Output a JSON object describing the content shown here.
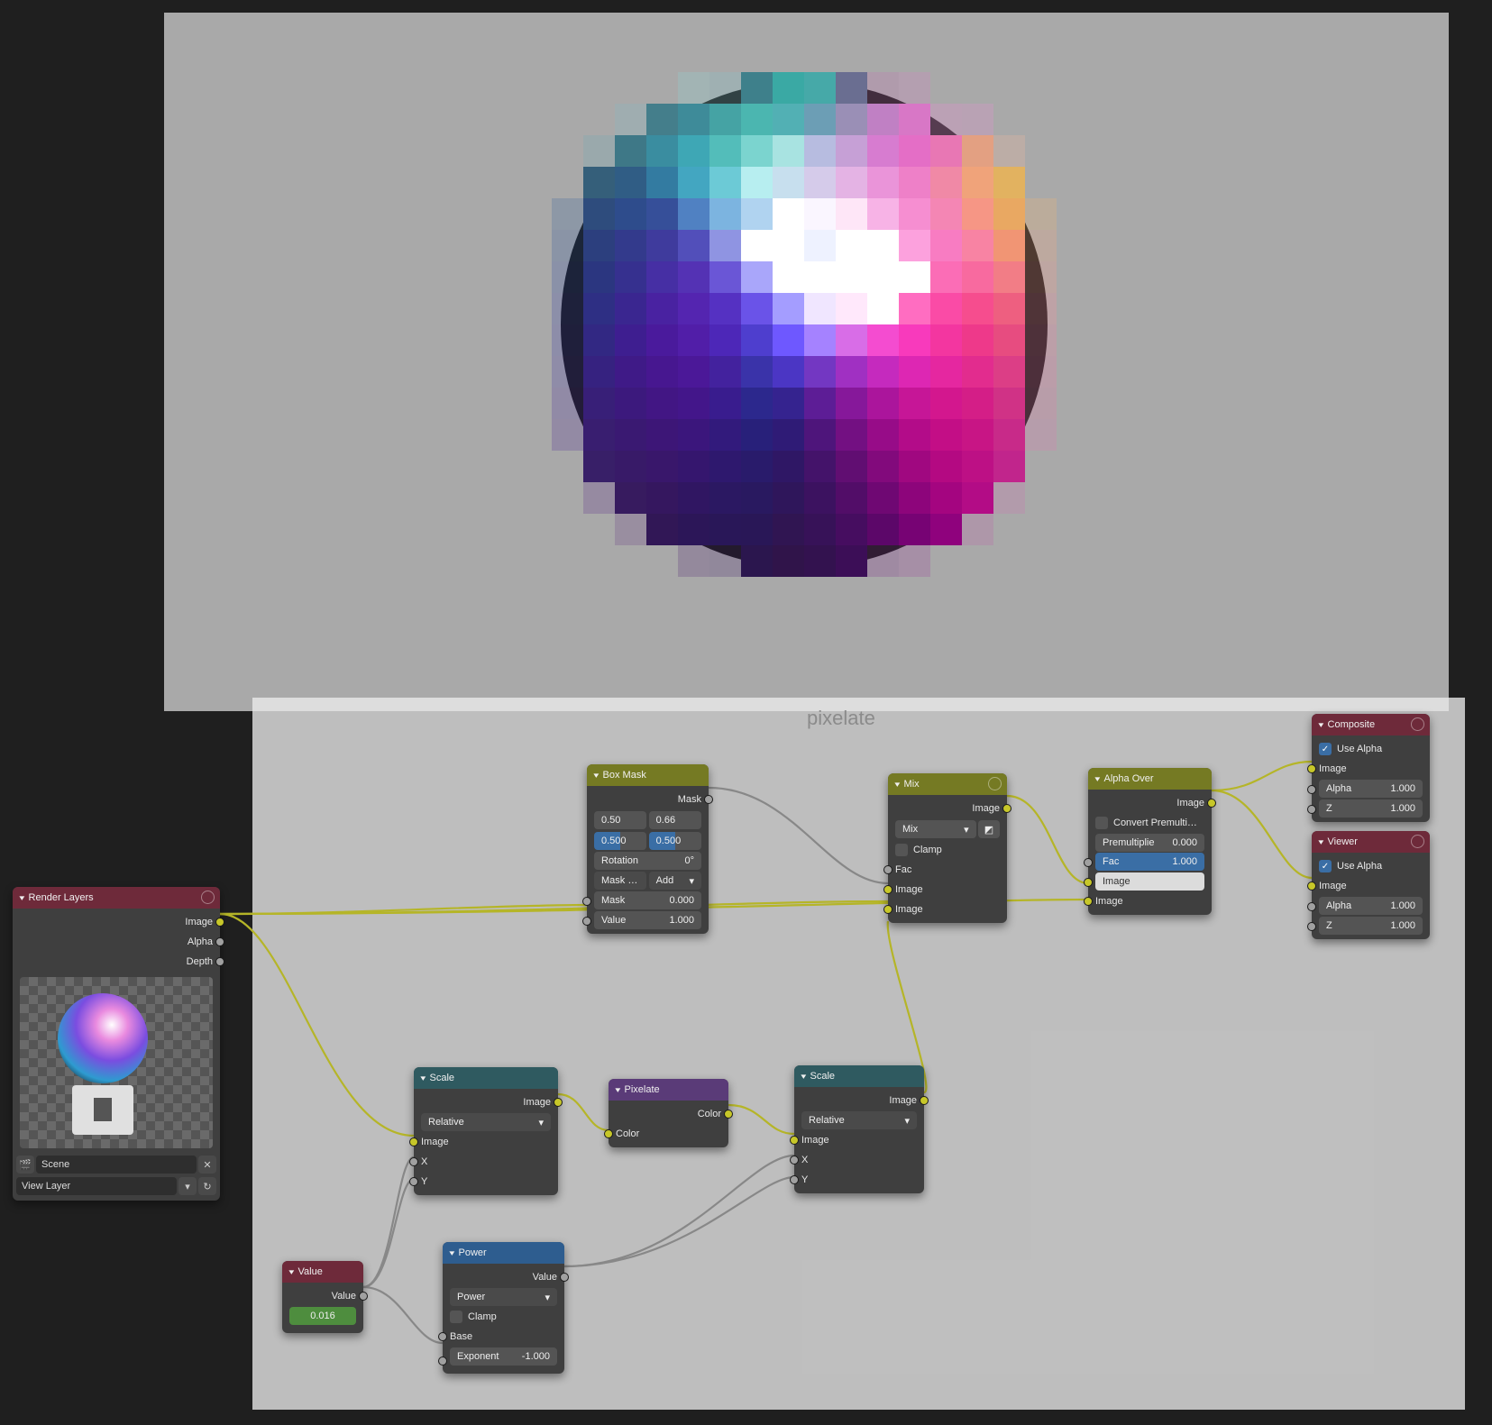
{
  "group_label": "pixelate",
  "render_layers": {
    "title": "Render Layers",
    "out_image": "Image",
    "out_alpha": "Alpha",
    "out_depth": "Depth",
    "scene_label": "Scene",
    "viewlayer_label": "View Layer"
  },
  "box_mask": {
    "title": "Box Mask",
    "out_mask": "Mask",
    "vals": [
      "0.50",
      "0.66",
      "0.500",
      "0.500"
    ],
    "rotation_lbl": "Rotation",
    "rotation_val": "0°",
    "masktype_lbl": "Mask …",
    "masktype_val": "Add",
    "in_mask_lbl": "Mask",
    "in_mask_val": "0.000",
    "in_value_lbl": "Value",
    "in_value_val": "1.000"
  },
  "mix": {
    "title": "Mix",
    "out_image": "Image",
    "mode": "Mix",
    "clamp": "Clamp",
    "in_fac": "Fac",
    "in_image1": "Image",
    "in_image2": "Image"
  },
  "alpha_over": {
    "title": "Alpha Over",
    "out_image": "Image",
    "convert": "Convert Premulti…",
    "premul_lbl": "Premultiplie",
    "premul_val": "0.000",
    "fac_lbl": "Fac",
    "fac_val": "1.000",
    "in_image1": "Image",
    "in_image2": "Image"
  },
  "composite": {
    "title": "Composite",
    "use_alpha": "Use Alpha",
    "in_image": "Image",
    "alpha_lbl": "Alpha",
    "alpha_val": "1.000",
    "z_lbl": "Z",
    "z_val": "1.000"
  },
  "viewer": {
    "title": "Viewer",
    "use_alpha": "Use Alpha",
    "in_image": "Image",
    "alpha_lbl": "Alpha",
    "alpha_val": "1.000",
    "z_lbl": "Z",
    "z_val": "1.000"
  },
  "scale1": {
    "title": "Scale",
    "out_image": "Image",
    "mode": "Relative",
    "in_image": "Image",
    "in_x": "X",
    "in_y": "Y"
  },
  "scale2": {
    "title": "Scale",
    "out_image": "Image",
    "mode": "Relative",
    "in_image": "Image",
    "in_x": "X",
    "in_y": "Y"
  },
  "pixelate": {
    "title": "Pixelate",
    "out_color": "Color",
    "in_color": "Color"
  },
  "value_node": {
    "title": "Value",
    "out_value": "Value",
    "val": "0.016"
  },
  "power": {
    "title": "Power",
    "out_value": "Value",
    "mode": "Power",
    "clamp": "Clamp",
    "in_base": "Base",
    "exp_lbl": "Exponent",
    "exp_val": "-1.000"
  },
  "pixel_colors": [
    [
      "",
      "",
      "",
      "",
      "rgba(150,200,200,0.35)",
      "rgba(140,190,195,0.35)",
      "#3e808b",
      "#3aa9a4",
      "#46a9a8",
      "#6a6e91",
      "rgba(188,128,178,0.35)",
      "rgba(200,140,190,0.35)",
      "",
      "",
      "",
      ""
    ],
    [
      "",
      "",
      "rgba(140,180,190,0.35)",
      "#447e8b",
      "#3e8b99",
      "#45a3a4",
      "#4bb6b0",
      "#52b0b4",
      "#6c9eb5",
      "#9a8fb6",
      "#c080c4",
      "#d877c6",
      "rgba(214,150,200,0.4)",
      "rgba(214,150,200,0.35)",
      "",
      ""
    ],
    [
      "",
      "rgba(120,170,180,0.3)",
      "#3e7887",
      "#3a8da0",
      "#3ea7b5",
      "#53bdba",
      "#7bd4cf",
      "#a8e3e1",
      "#b7bce0",
      "#c6a0d6",
      "#d77cd0",
      "#e46ec6",
      "#e877b4",
      "#e3a082",
      "rgba(224,180,160,0.35)",
      ""
    ],
    [
      "",
      "#355f7a",
      "#305d85",
      "#337ba1",
      "#43a6c1",
      "#6ccad6",
      "#b7eef0",
      "#c7dfee",
      "#d5cbea",
      "#e4b3e4",
      "#ea94d9",
      "#ee80c8",
      "#f089a6",
      "#f0a37a",
      "#e2b260",
      ""
    ],
    [
      "rgba(90,120,160,0.35)",
      "#2e4c7d",
      "#2e4c8c",
      "#364f99",
      "#5081c2",
      "#7cb4e0",
      "#b0d3f0",
      "#ffffff",
      "#faf6ff",
      "#fee6f7",
      "#f7b3e6",
      "#f68ed1",
      "#f486b4",
      "#f69685",
      "#e9a862",
      "rgba(222,178,130,0.35)"
    ],
    [
      "rgba(80,110,160,0.35)",
      "#2c3f7e",
      "#333a8c",
      "#3f3b9d",
      "#524fba",
      "#8f94e2",
      "#ffffff",
      "#ffffff",
      "#eef2ff",
      "#ffffff",
      "#ffffff",
      "#fca1dd",
      "#f87cc2",
      "#f883a3",
      "#f19574",
      "rgba(226,170,140,0.35)"
    ],
    [
      "rgba(80,100,165,0.35)",
      "#2b3680",
      "#36308f",
      "#462fa4",
      "#5432b4",
      "#6a56d6",
      "#a9a6fa",
      "#ffffff",
      "#ffffff",
      "#ffffff",
      "#ffffff",
      "#ffffff",
      "#fb6db6",
      "#f86a9f",
      "#f27d86",
      "rgba(230,160,150,0.35)"
    ],
    [
      "rgba(85,95,170,0.35)",
      "#2e2f84",
      "#3a2690",
      "#4922a1",
      "#5425b0",
      "#5531c2",
      "#6a53e8",
      "#a49dff",
      "#f0e6ff",
      "#ffe8fb",
      "#ffffff",
      "#ff6dc1",
      "#fa4ba6",
      "#f64d8e",
      "#ee5f80",
      "rgba(228,148,160,0.35)"
    ],
    [
      "rgba(90,90,170,0.35)",
      "#322883",
      "#3e1e90",
      "#4a1a9c",
      "#511ea8",
      "#4d27b8",
      "#4e3ece",
      "#6e58ff",
      "#a582ff",
      "#d86de7",
      "#f44cd0",
      "#f83abc",
      "#f336a0",
      "#ee398a",
      "#e74c80",
      "rgba(224,140,165,0.35)"
    ],
    [
      "rgba(95,85,165,0.35)",
      "#362280",
      "#3f1a87",
      "#471790",
      "#4b1898",
      "#43229e",
      "#3a33a9",
      "#4b36c4",
      "#7337c2",
      "#a030c2",
      "#c52abe",
      "#dd27b3",
      "#e527a0",
      "#e22c8e",
      "#dc3e86",
      "rgba(220,135,170,0.35)"
    ],
    [
      "rgba(100,80,160,0.35)",
      "#381f78",
      "#3c197d",
      "#421684",
      "#43168a",
      "#391c8e",
      "#2c288d",
      "#35238f",
      "#5d1d96",
      "#86189a",
      "#ab159c",
      "#c61697",
      "#d3178e",
      "#d41e87",
      "#d03286",
      "rgba(212,135,170,0.35)"
    ],
    [
      "rgba(105,80,155,0.35)",
      "#391e70",
      "#3a1972",
      "#3d1677",
      "#3b167c",
      "#321a7c",
      "#28207a",
      "#2f1b76",
      "#4e157b",
      "#731082",
      "#970c88",
      "#b30c89",
      "#c30e86",
      "#c81585",
      "#c82a89",
      "rgba(206,135,175,0.35)"
    ],
    [
      "",
      "#381f68",
      "#381a68",
      "#39176b",
      "#35166e",
      "#2e186e",
      "#291b6b",
      "#2f1765",
      "#44136a",
      "#610e72",
      "#820a7c",
      "#a00880",
      "#b40982",
      "#bd1085",
      "#c1258c",
      ""
    ],
    [
      "",
      "rgba(115,80,145,0.35)",
      "#371b5f",
      "#35175f",
      "#301662",
      "#2b1862",
      "#291960",
      "#2f165b",
      "#3c1260",
      "#520d68",
      "#6f0873",
      "#8d057b",
      "#a40580",
      "#b30c86",
      "rgba(196,130,175,0.35)",
      ""
    ],
    [
      "",
      "",
      "rgba(115,80,140,0.3)",
      "#311756",
      "#2c1658",
      "#291758",
      "#291757",
      "#301552",
      "#371258",
      "#460d60",
      "#5c0769",
      "#770374",
      "#8f027d",
      "rgba(182,118,170,0.35)",
      "",
      ""
    ],
    [
      "",
      "",
      "",
      "",
      "rgba(108,78,132,0.35)",
      "rgba(100,75,130,0.35)",
      "#2b164e",
      "#30144a",
      "#33124f",
      "#3c0e57",
      "rgba(140,80,150,0.35)",
      "rgba(160,95,160,0.35)",
      "",
      "",
      "",
      ""
    ]
  ]
}
